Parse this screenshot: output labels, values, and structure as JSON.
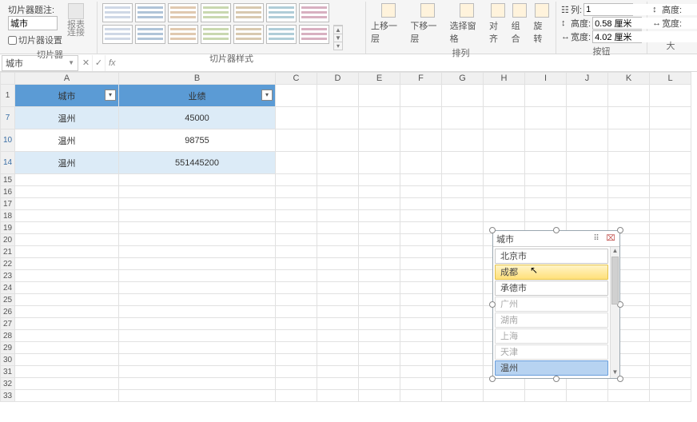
{
  "ribbon": {
    "slicer": {
      "title_label": "切片器题注:",
      "title_value": "城市",
      "settings_label": "切片器设置",
      "report_conn": "报表\n连接",
      "group_label": "切片器"
    },
    "styles": {
      "group_label": "切片器样式"
    },
    "arrange": {
      "bring_fwd": "上移一层",
      "send_back": "下移一层",
      "selection": "选择窗格",
      "align": "对齐",
      "group": "组合",
      "rotate": "旋转",
      "group_label": "排列"
    },
    "buttons": {
      "cols_label": "列:",
      "cols_val": "1",
      "height_label": "高度:",
      "height_val": "0.58 厘米",
      "width_label": "宽度:",
      "width_val": "4.02 厘米",
      "group_label": "按钮"
    },
    "size": {
      "height_label": "高度:",
      "width_label": "宽度:",
      "group_label": "大"
    }
  },
  "formula_bar": {
    "name_box": "城市",
    "fx": "fx"
  },
  "columns": [
    "A",
    "B",
    "C",
    "D",
    "E",
    "F",
    "G",
    "H",
    "I",
    "J",
    "K",
    "L"
  ],
  "row_numbers": [
    "1",
    "7",
    "10",
    "14",
    "15",
    "16",
    "17",
    "18",
    "19",
    "20",
    "21",
    "22",
    "23",
    "24",
    "25",
    "26",
    "27",
    "28",
    "29",
    "30",
    "31",
    "32",
    "33"
  ],
  "table": {
    "headers": [
      "城市",
      "业绩"
    ],
    "rows": [
      {
        "city": "温州",
        "value": "45000"
      },
      {
        "city": "温州",
        "value": "98755"
      },
      {
        "city": "温州",
        "value": "551445200"
      }
    ]
  },
  "slicer": {
    "title": "城市",
    "items": [
      {
        "label": "北京市",
        "state": "normal"
      },
      {
        "label": "成都",
        "state": "hl"
      },
      {
        "label": "承德市",
        "state": "normal"
      },
      {
        "label": "广州",
        "state": "dim"
      },
      {
        "label": "湖南",
        "state": "dim"
      },
      {
        "label": "上海",
        "state": "dim"
      },
      {
        "label": "天津",
        "state": "dim"
      },
      {
        "label": "温州",
        "state": "sel"
      }
    ]
  }
}
